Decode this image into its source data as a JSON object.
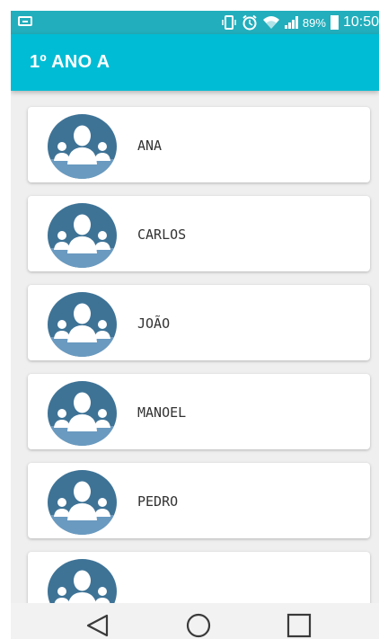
{
  "status_bar": {
    "battery_percent": "89%",
    "time": "10:50",
    "icons": [
      "voicemail-icon",
      "vibrate-icon",
      "alarm-icon",
      "wifi-icon",
      "signal-icon",
      "battery-icon"
    ]
  },
  "app_bar": {
    "title": "1º ANO A",
    "color": "#00bcd4"
  },
  "students": [
    {
      "name": "ANA"
    },
    {
      "name": "CARLOS"
    },
    {
      "name": "JOÃO"
    },
    {
      "name": "MANOEL"
    },
    {
      "name": "PEDRO"
    },
    {
      "name": ""
    }
  ],
  "navigation": {
    "buttons": [
      "back-icon",
      "home-icon",
      "recents-icon"
    ]
  }
}
